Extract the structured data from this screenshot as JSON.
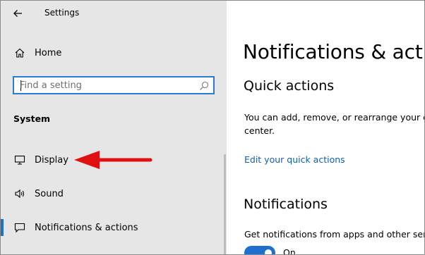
{
  "window": {
    "title": "Settings"
  },
  "sidebar": {
    "home_label": "Home",
    "search": {
      "placeholder": "Find a setting"
    },
    "section_heading": "System",
    "items": [
      {
        "label": "Display",
        "icon": "monitor-icon"
      },
      {
        "label": "Sound",
        "icon": "speaker-icon"
      },
      {
        "label": "Notifications & actions",
        "icon": "notification-icon",
        "active": true
      }
    ]
  },
  "main": {
    "title": "Notifications & actions",
    "quick_actions": {
      "heading": "Quick actions",
      "description_line1": "You can add, remove, or rearrange your quick actions directly in action",
      "description_line2": "center.",
      "link": "Edit your quick actions"
    },
    "notifications": {
      "heading": "Notifications",
      "description": "Get notifications from apps and other senders",
      "toggle_state": "On"
    }
  },
  "colors": {
    "accent": "#1f6fcf",
    "sidebar_bg": "#e6e6e6",
    "annotation_arrow": "#e01010",
    "link": "#0b5fbf"
  }
}
